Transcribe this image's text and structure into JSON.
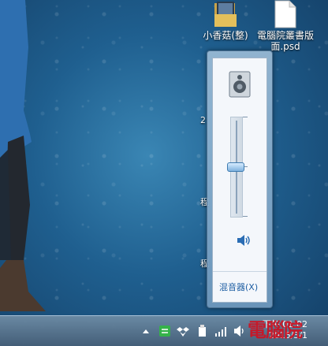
{
  "desktop": {
    "icons": [
      {
        "label": "小香菇(整)",
        "icon": "folder-icon"
      },
      {
        "label": "電腦院叢書版面.psd",
        "icon": "psd-file-icon"
      }
    ],
    "side_fragments": [
      "2",
      "程",
      "程"
    ]
  },
  "volume_flyout": {
    "device_icon": "speaker-device-icon",
    "level_percent": 50,
    "mute_icon": "speaker-volume-icon",
    "mixer_label": "混音器(X)"
  },
  "taskbar": {
    "tray_icons": [
      "show-hidden-icons-arrow",
      "line-icon",
      "dropbox-icon",
      "flashdrive-icon",
      "network-signal-icon",
      "volume-icon"
    ],
    "clock_time": "下午 01:02",
    "clock_date": "2015/3/1"
  },
  "watermark": {
    "text": "電腦院"
  },
  "colors": {
    "accent": "#1f5fa3",
    "wallpaper": "#1f5f8f"
  }
}
